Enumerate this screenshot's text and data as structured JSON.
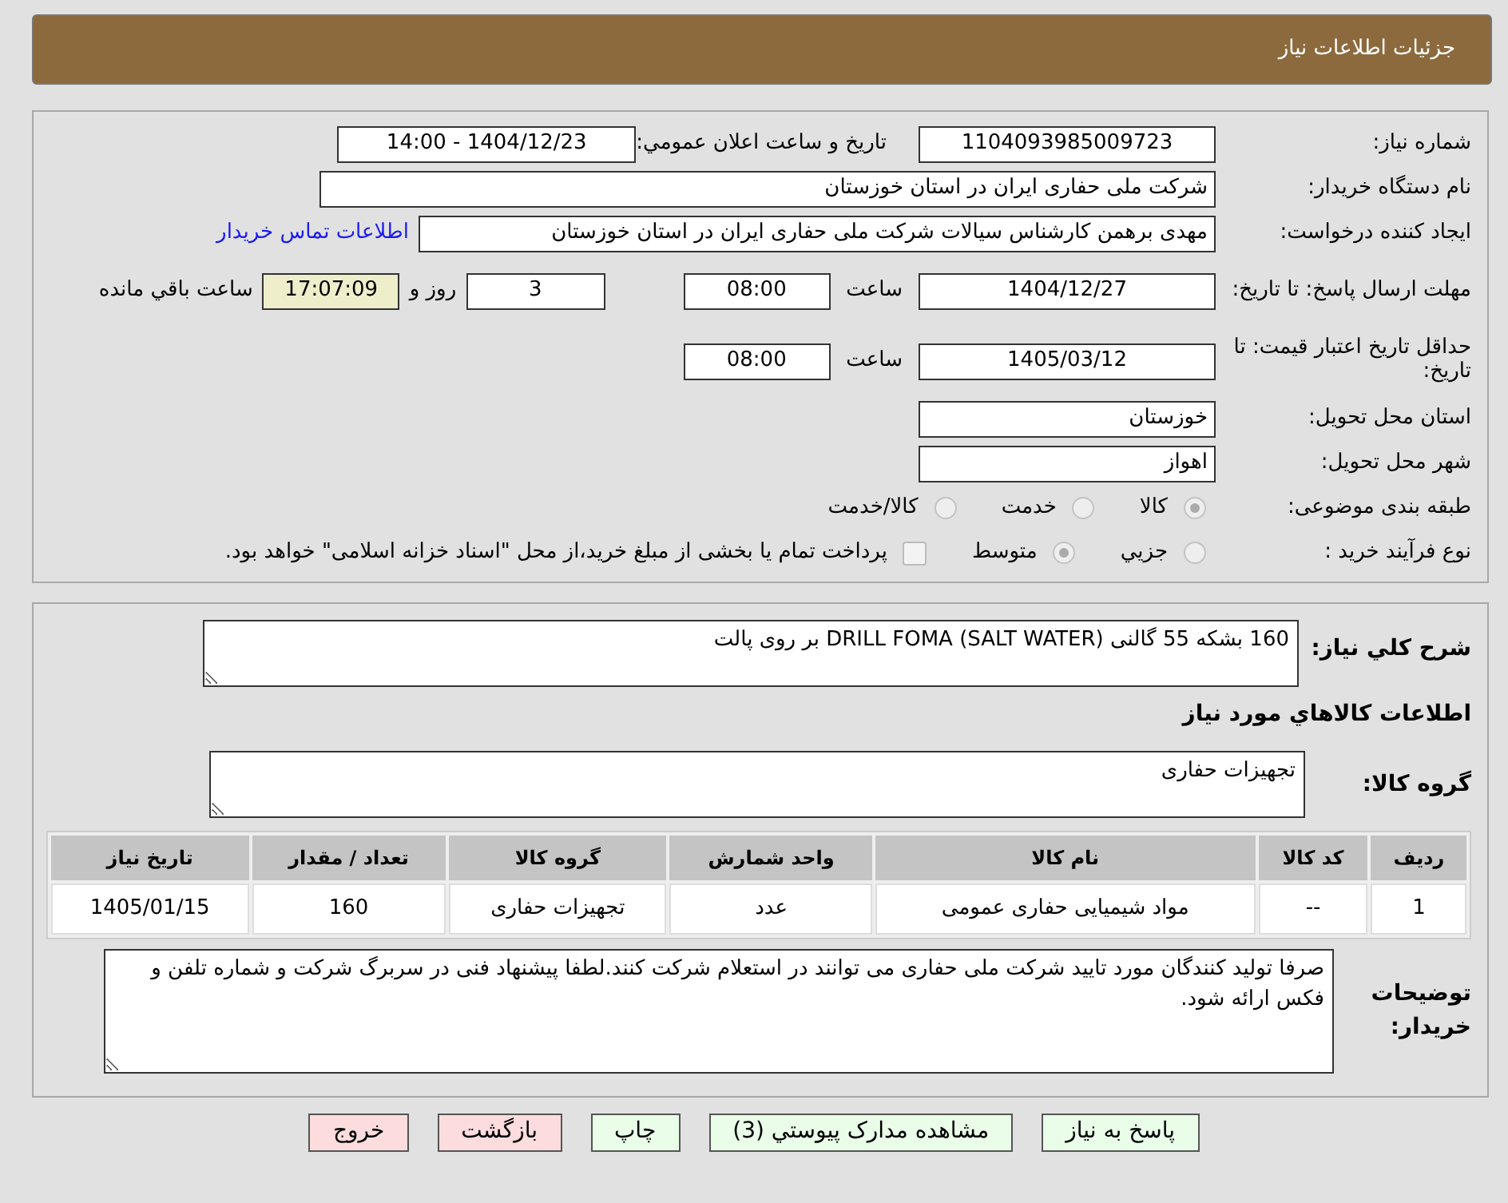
{
  "header": {
    "title": "جزئیات اطلاعات نیاز"
  },
  "need_number": {
    "label": "شماره نیاز:",
    "value": "1104093985009723"
  },
  "announce": {
    "label": "تاريخ و ساعت اعلان عمومي:",
    "value": "1404/12/23 - 14:00"
  },
  "buyer": {
    "label": "نام دستگاه خریدار:",
    "value": "شرکت ملی حفاری ایران در استان خوزستان"
  },
  "requester": {
    "label": "ایجاد کننده درخواست:",
    "value": "مهدی برهمن کارشناس سیالات شرکت ملی حفاری ایران در استان خوزستان",
    "link": "اطلاعات تماس خریدار"
  },
  "deadline": {
    "label": "مهلت ارسال پاسخ: تا تاریخ:",
    "date": "1404/12/27",
    "time_label": "ساعت",
    "time": "08:00",
    "days": "3",
    "days_label": "روز و",
    "remaining": "17:07:09",
    "remaining_label": "ساعت باقي مانده"
  },
  "validity": {
    "label": "حداقل تاریخ اعتبار قیمت: تا تاریخ:",
    "date": "1405/03/12",
    "time_label": "ساعت",
    "time": "08:00"
  },
  "province": {
    "label": "استان محل تحویل:",
    "value": "خوزستان"
  },
  "city": {
    "label": "شهر محل تحویل:",
    "value": "اهواز"
  },
  "category": {
    "label": "طبقه بندی موضوعی:",
    "options": [
      {
        "label": "کالا",
        "selected": true
      },
      {
        "label": "خدمت",
        "selected": false
      },
      {
        "label": "کالا/خدمت",
        "selected": false
      }
    ]
  },
  "process": {
    "label": "نوع فرآیند خرید :",
    "options": [
      {
        "label": "جزيي",
        "selected": false
      },
      {
        "label": "متوسط",
        "selected": true
      }
    ],
    "payment": {
      "checked": false,
      "text": "پرداخت تمام یا بخشی از مبلغ خرید،از محل \"اسناد خزانه اسلامی\" خواهد بود."
    }
  },
  "description": {
    "label": "شرح کلي نياز:",
    "value": "160 بشکه 55 گالنی DRILL FOMA (SALT WATER) بر روی پالت"
  },
  "goods_title": "اطلاعات کالاهاي مورد نياز",
  "goods_group": {
    "label": "گروه کالا:",
    "value": "تجهیزات حفاری"
  },
  "table": {
    "columns": [
      "رديف",
      "کد کالا",
      "نام کالا",
      "واحد شمارش",
      "گروه کالا",
      "تعداد / مقدار",
      "تاریخ نیاز"
    ],
    "rows": [
      [
        "1",
        "--",
        "مواد شیمیایی حفاری عمومی",
        "عدد",
        "تجهیزات حفاری",
        "160",
        "1405/01/15"
      ]
    ]
  },
  "notes": {
    "label": "توضیحات خریدار:",
    "value": "صرفا تولید کنندگان مورد تایید شرکت ملی حفاری می توانند در استعلام شرکت کنند.لطفا پیشنهاد فنی در سربرگ شرکت و شماره تلفن و فکس ارائه شود."
  },
  "buttons": [
    {
      "label": "پاسخ به نياز",
      "kind": "go"
    },
    {
      "label": "مشاهده مدارک پيوستي (3)",
      "kind": "go"
    },
    {
      "label": "چاپ",
      "kind": "go"
    },
    {
      "label": "بازگشت",
      "kind": "stop"
    },
    {
      "label": "خروج",
      "kind": "stop"
    }
  ]
}
